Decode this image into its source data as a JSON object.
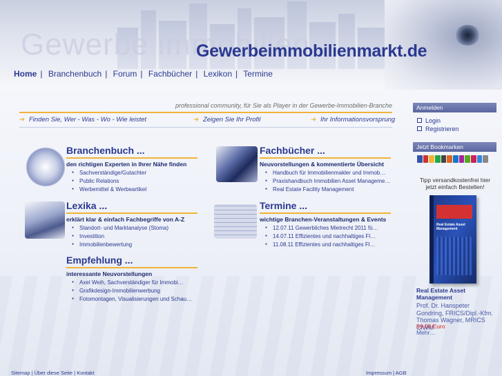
{
  "header": {
    "site_title": "Gewerbeimmobilienmarkt.de",
    "ghost_text": "Gewerbe immobilien"
  },
  "nav": {
    "items": [
      "Home",
      "Branchenbuch",
      "Forum",
      "Fachbücher",
      "Lexikon",
      "Termine"
    ],
    "active": "Home"
  },
  "tagline": "professional community, für Sie als Player in der Gewerbe-Immobilien-Branche",
  "quicklinks": [
    "Finden Sie, Wer - Was - Wo - Wie leistet",
    "Zeigen Sie Ihr Profil",
    "Ihr Informationsvorsprung"
  ],
  "sections": {
    "branchenbuch": {
      "title": "Branchenbuch ...",
      "subtitle": "den richtigen Experten in Ihrer Nähe finden",
      "items": [
        "Sachverständige/Gutachter",
        "Public Relations",
        "Werbemittel & Werbeartikel"
      ]
    },
    "fachbuecher": {
      "title": "Fachbücher ...",
      "subtitle": "Neuvorstellungen & kommentierte Übersicht",
      "items": [
        "Handbuch für Immobilienmakler und Immob…",
        "Praxishandbuch Immobilien Asset Manageme…",
        "Real Estate Facility Management"
      ]
    },
    "lexika": {
      "title": "Lexika ...",
      "subtitle": "erklärt klar & einfach Fachbegriffe von A-Z",
      "items": [
        "Standort- und Marktanalyse (Stoma)",
        "Investition",
        "Immobilienbewertung"
      ]
    },
    "termine": {
      "title": "Termine ...",
      "subtitle": "wichtige Branchen-Veranstaltungen & Events",
      "items": [
        "12.07.11 Gewerbliches Mietrecht 2011 fü…",
        "14.07.11 Effizientes und nachhaltiges Fl…",
        "11.08.11 Effizientes und nachhaltiges Fl…"
      ]
    },
    "empfehlung": {
      "title": "Empfehlung ...",
      "subtitle": "interessante Neuvorstellungen",
      "items": [
        "Axel Weih, Sachverständiger für Immobi…",
        "Grafikdesign-Immobilienwerbung",
        "Fotomontagen, Visualisierungen und Schau…"
      ]
    }
  },
  "sidebar": {
    "anmelden_head": "Anmelden",
    "login": "Login",
    "register": "Registrieren",
    "bookmark_head": "Jetzt Bookmarken",
    "bookmark_colors": [
      "#3355aa",
      "#cc3333",
      "#f2b336",
      "#22aa44",
      "#444444",
      "#dd6622",
      "#1177cc",
      "#aa2299",
      "#55aa22",
      "#cc2255",
      "#3388dd",
      "#888888"
    ],
    "promo": "Tipp versandkostenfrei hier jetzt einfach Bestellen!",
    "book_title": "Real Estate Asset Management",
    "book_author": "Prof. Dr. Hanspeter Gondring, FRICS/Dipl.-Kfm. Thomas Wagner, MRICS CIWM",
    "book_price": "59,00 Euro",
    "book_more": "Mehr…"
  },
  "footer": {
    "left": "Sitemap | Über diese Seite | Kontakt",
    "right": "Impressum | AGB"
  }
}
